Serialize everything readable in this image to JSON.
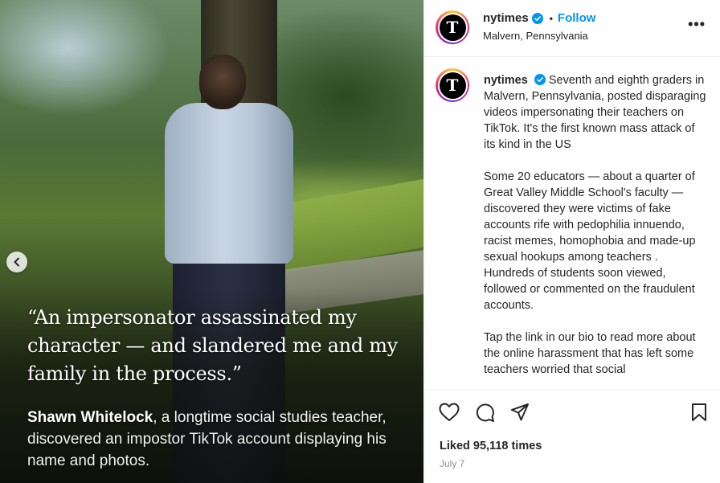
{
  "post": {
    "quote": "“An impersonator assassinated my character — and slandered me and my family in the process.”",
    "caption_name": "Shawn Whitelock",
    "caption_rest": ", a longtime social studies teacher, discovered an impostor TikTok account displaying his name and photos."
  },
  "header": {
    "username": "nytimes",
    "follow_label": "Follow",
    "location": "Malvern, Pennsylvania",
    "more_label": "•••",
    "logo_letter": "T"
  },
  "comment": {
    "username": "nytimes",
    "paragraph1": "Seventh and eighth graders in Malvern, Pennsylvania, posted disparaging videos impersonating their teachers on TikTok. It's the first known mass attack of its kind in the US",
    "paragraph2": "Some 20 educators — about a quarter of Great Valley Middle School's faculty — discovered they were victims of fake accounts rife with pedophilia innuendo, racist memes, homophobia and made-up sexual hookups among teachers . Hundreds of students soon viewed, followed or commented on the fraudulent accounts.",
    "paragraph3": "Tap the link in our bio to read more about the online harassment that has left some teachers worried that social"
  },
  "footer": {
    "likes": "Liked 95,118 times",
    "date": "July 7"
  },
  "colors": {
    "accent": "#0095f6",
    "verified": "#0095f6",
    "text": "#262626",
    "muted": "#8e8e8e"
  },
  "icons": [
    "chevron-left-icon",
    "verified-icon",
    "more-icon",
    "heart-icon",
    "comment-icon",
    "share-icon",
    "bookmark-icon"
  ]
}
